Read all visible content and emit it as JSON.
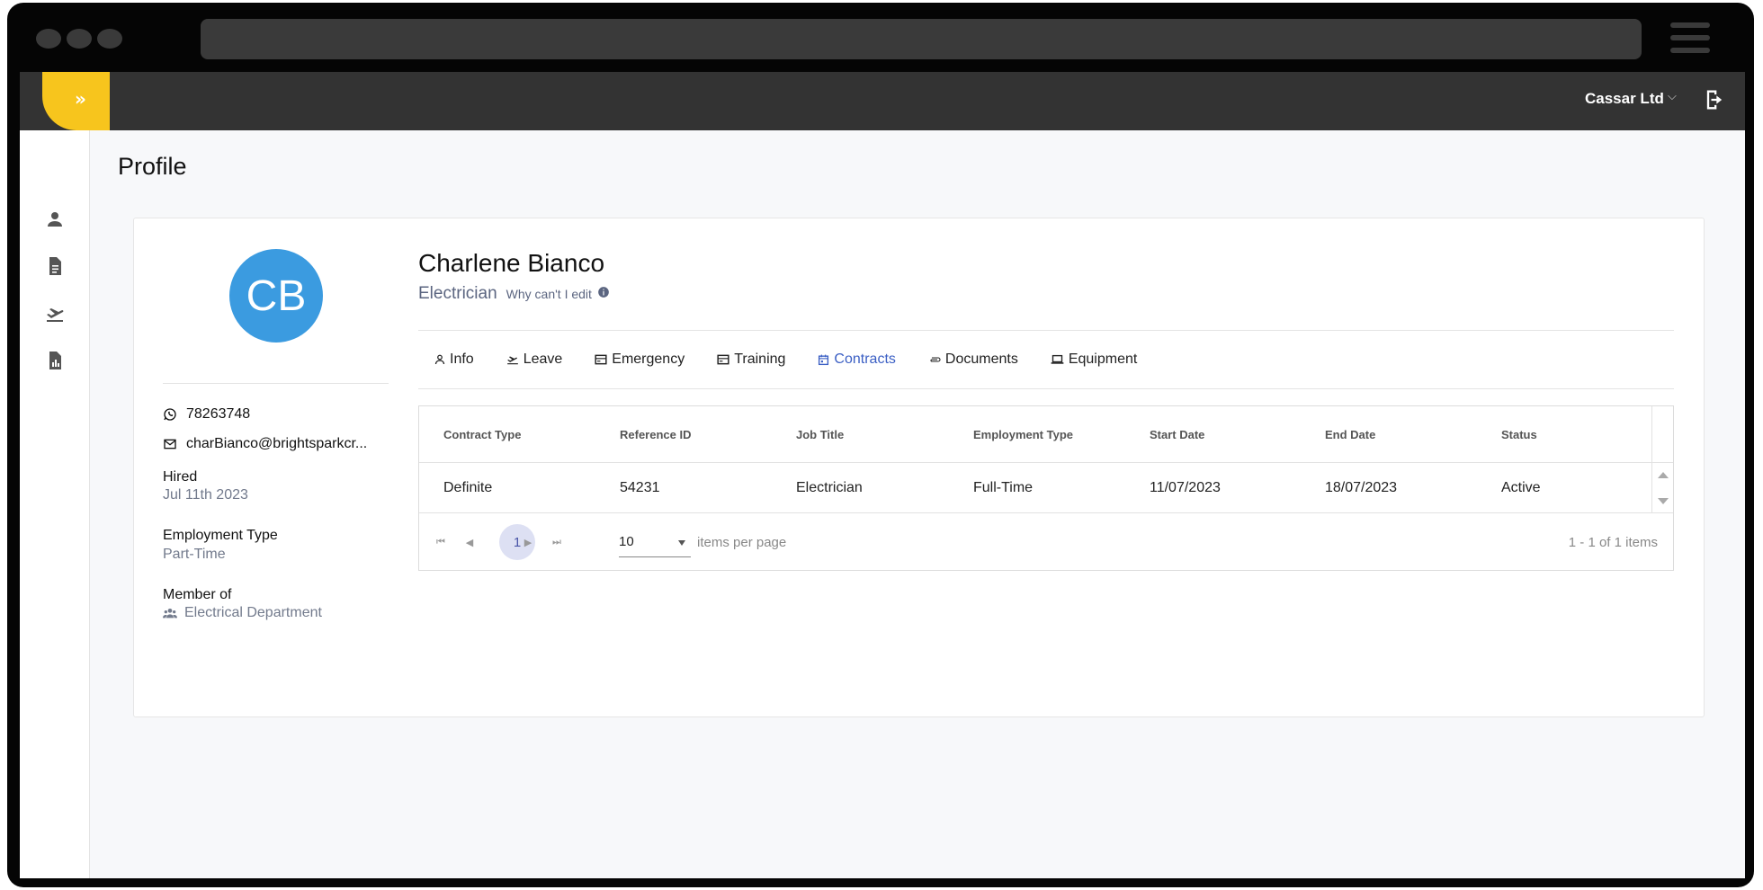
{
  "header": {
    "company": "Cassar Ltd"
  },
  "page": {
    "title": "Profile"
  },
  "profile": {
    "initials": "CB",
    "name": "Charlene Bianco",
    "role": "Electrician",
    "why_edit": "Why can't I edit",
    "phone": "78263748",
    "email": "charBianco@brightsparkcr...",
    "hired_label": "Hired",
    "hired_value": "Jul 11th 2023",
    "employment_type_label": "Employment Type",
    "employment_type_value": "Part-Time",
    "member_of_label": "Member of",
    "member_of_value": "Electrical Department"
  },
  "tabs": [
    {
      "label": "Info",
      "icon": "person-icon",
      "active": false
    },
    {
      "label": "Leave",
      "icon": "plane-icon",
      "active": false
    },
    {
      "label": "Emergency",
      "icon": "card-icon",
      "active": false
    },
    {
      "label": "Training",
      "icon": "card-icon",
      "active": false
    },
    {
      "label": "Contracts",
      "icon": "calendar-icon",
      "active": true
    },
    {
      "label": "Documents",
      "icon": "paperclip-icon",
      "active": false
    },
    {
      "label": "Equipment",
      "icon": "laptop-icon",
      "active": false
    }
  ],
  "table": {
    "headers": [
      "Contract Type",
      "Reference ID",
      "Job Title",
      "Employment Type",
      "Start Date",
      "End Date",
      "Status"
    ],
    "rows": [
      [
        "Definite",
        "54231",
        "Electrician",
        "Full-Time",
        "11/07/2023",
        "18/07/2023",
        "Active"
      ]
    ]
  },
  "pager": {
    "current_page": "1",
    "page_size": "10",
    "items_per_page_label": "items per page",
    "items_info": "1 - 1 of 1 items"
  },
  "colors": {
    "accent": "#f7c51d",
    "topbar": "#333333",
    "avatar": "#3b9be0",
    "active_tab": "#3b5fc4"
  }
}
